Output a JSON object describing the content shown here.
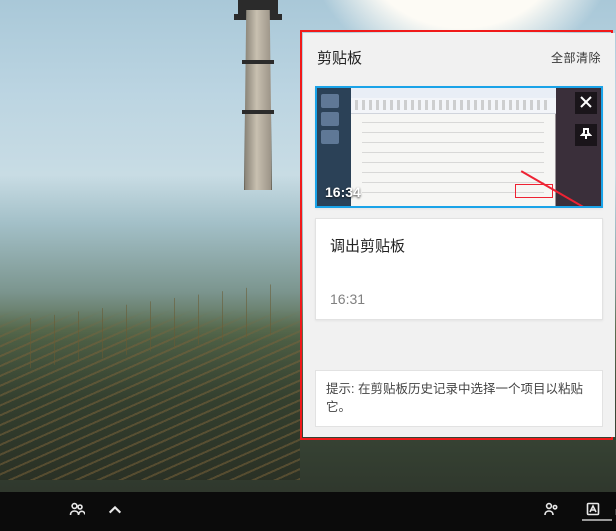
{
  "clipboard": {
    "title": "剪贴板",
    "clear_all": "全部清除",
    "items": [
      {
        "kind": "image",
        "time": "16:34",
        "selected": true
      },
      {
        "kind": "text",
        "content": "调出剪贴板",
        "time": "16:31",
        "selected": false
      }
    ],
    "hint_prefix": "提示: ",
    "hint_body": "在剪贴板历史记录中选择一个项目以粘贴它。"
  },
  "taskbar": {
    "icons": {
      "people": "people-icon",
      "tray_chevron": "tray-chevron-icon",
      "network_warn": "network-icon"
    }
  }
}
